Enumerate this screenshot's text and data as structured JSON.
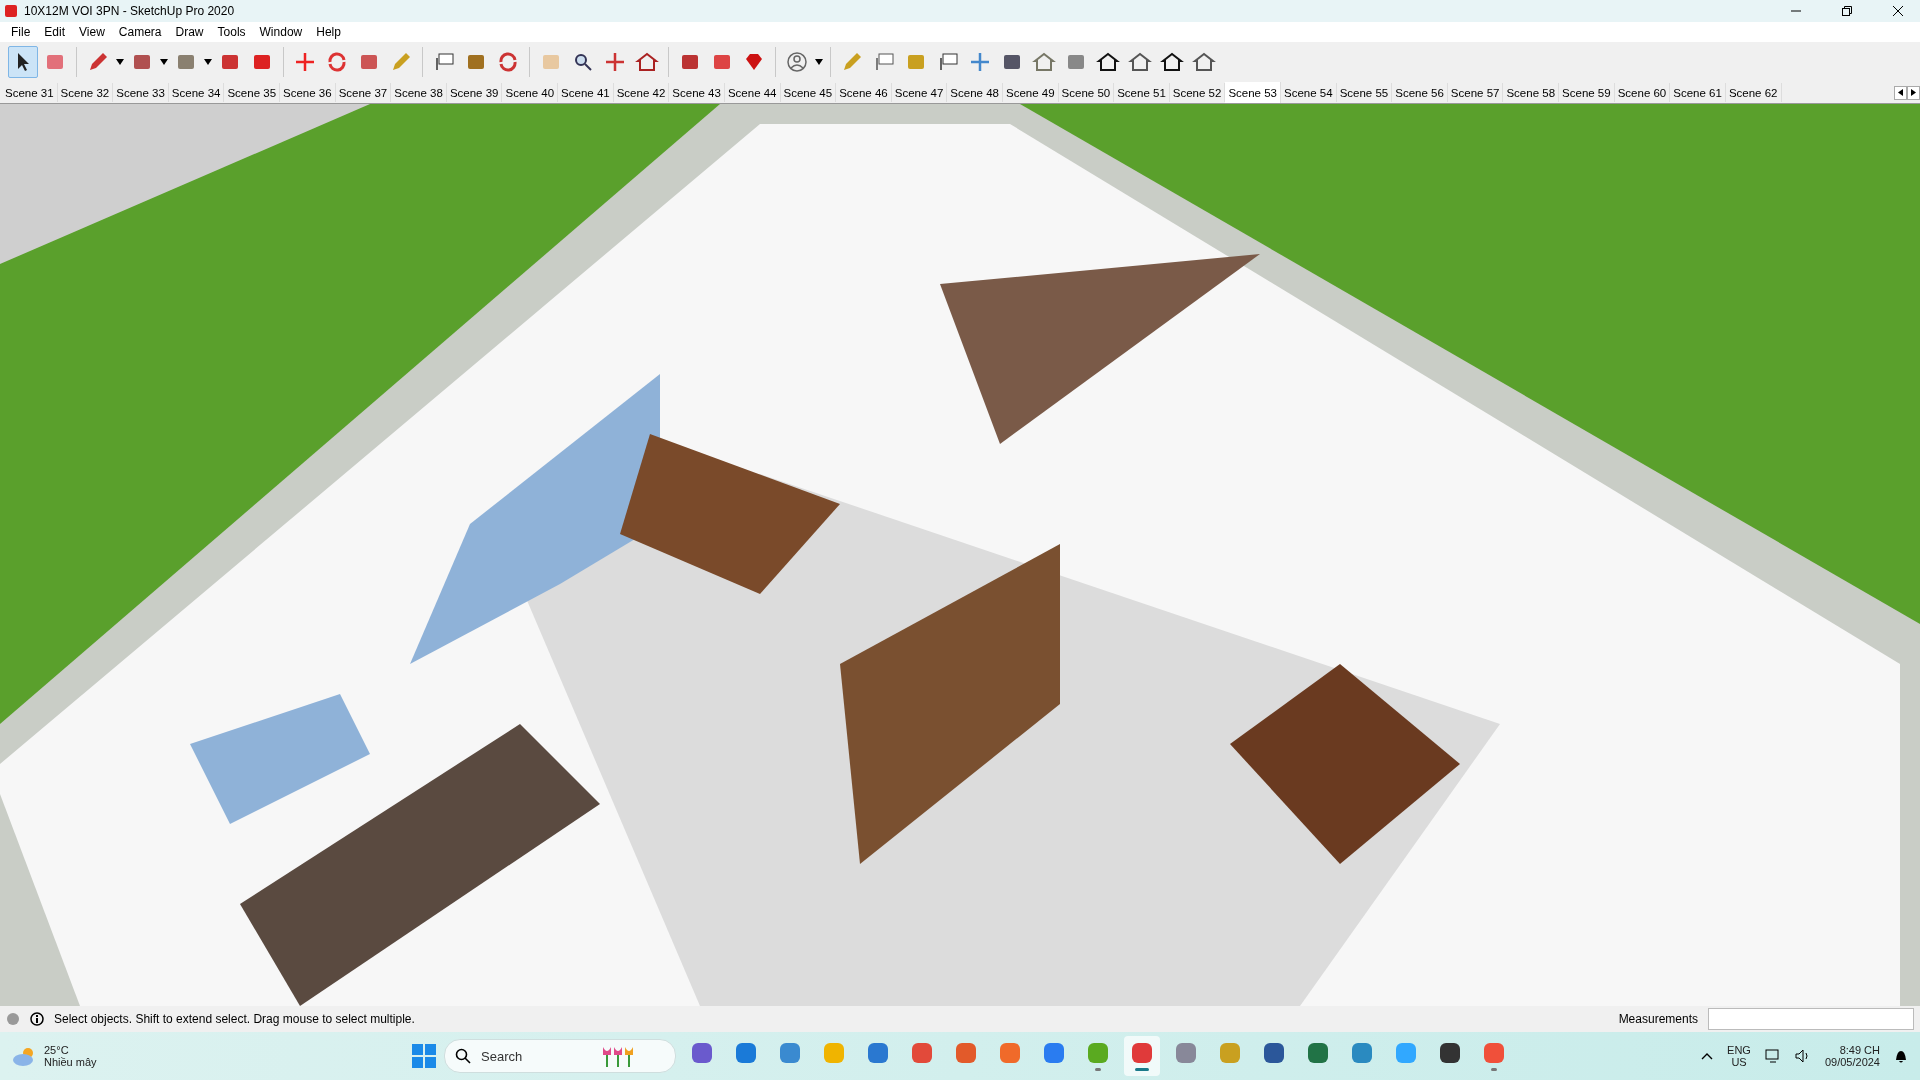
{
  "window": {
    "title": "10X12M VOI 3PN - SketchUp Pro 2020"
  },
  "menu": [
    "File",
    "Edit",
    "View",
    "Camera",
    "Draw",
    "Tools",
    "Window",
    "Help"
  ],
  "toolbar": [
    {
      "selected": true,
      "dropdown": false
    },
    {
      "selected": false,
      "dropdown": false
    },
    {
      "selected": false,
      "dropdown": true
    },
    {
      "selected": false,
      "dropdown": true
    },
    {
      "selected": false,
      "dropdown": true
    },
    {
      "selected": false,
      "dropdown": false
    },
    {
      "selected": false,
      "dropdown": false
    },
    {
      "selected": false,
      "dropdown": false
    },
    {
      "selected": false,
      "dropdown": false
    },
    {
      "selected": false,
      "dropdown": false
    },
    {
      "selected": false,
      "dropdown": false
    },
    {
      "selected": false,
      "dropdown": false
    },
    {
      "selected": false,
      "dropdown": false
    },
    {
      "selected": false,
      "dropdown": false
    },
    {
      "selected": false,
      "dropdown": false
    },
    {
      "selected": false,
      "dropdown": false
    },
    {
      "selected": false,
      "dropdown": false
    },
    {
      "selected": false,
      "dropdown": false
    },
    {
      "selected": false,
      "dropdown": false
    },
    {
      "selected": false,
      "dropdown": false
    },
    {
      "selected": false,
      "dropdown": false
    },
    {
      "selected": false,
      "dropdown": true
    },
    {
      "selected": false,
      "dropdown": false
    },
    {
      "selected": false,
      "dropdown": false
    },
    {
      "selected": false,
      "dropdown": false
    },
    {
      "selected": false,
      "dropdown": false
    },
    {
      "selected": false,
      "dropdown": false
    },
    {
      "selected": false,
      "dropdown": false
    },
    {
      "selected": false,
      "dropdown": false
    },
    {
      "selected": false,
      "dropdown": false
    },
    {
      "selected": false,
      "dropdown": false
    },
    {
      "selected": false,
      "dropdown": false
    },
    {
      "selected": false,
      "dropdown": false
    },
    {
      "selected": false,
      "dropdown": false
    }
  ],
  "scenes": [
    {
      "label": "Scene 31",
      "selected": false
    },
    {
      "label": "Scene 32",
      "selected": false
    },
    {
      "label": "Scene 33",
      "selected": false
    },
    {
      "label": "Scene 34",
      "selected": false
    },
    {
      "label": "Scene 35",
      "selected": false
    },
    {
      "label": "Scene 36",
      "selected": false
    },
    {
      "label": "Scene 37",
      "selected": false
    },
    {
      "label": "Scene 38",
      "selected": false
    },
    {
      "label": "Scene 39",
      "selected": false
    },
    {
      "label": "Scene 40",
      "selected": false
    },
    {
      "label": "Scene 41",
      "selected": false
    },
    {
      "label": "Scene 42",
      "selected": false
    },
    {
      "label": "Scene 43",
      "selected": false
    },
    {
      "label": "Scene 44",
      "selected": false
    },
    {
      "label": "Scene 45",
      "selected": false
    },
    {
      "label": "Scene 46",
      "selected": false
    },
    {
      "label": "Scene 47",
      "selected": false
    },
    {
      "label": "Scene 48",
      "selected": false
    },
    {
      "label": "Scene 49",
      "selected": false
    },
    {
      "label": "Scene 50",
      "selected": false
    },
    {
      "label": "Scene 51",
      "selected": false
    },
    {
      "label": "Scene 52",
      "selected": false
    },
    {
      "label": "Scene 53",
      "selected": true
    },
    {
      "label": "Scene 54",
      "selected": false
    },
    {
      "label": "Scene 55",
      "selected": false
    },
    {
      "label": "Scene 56",
      "selected": false
    },
    {
      "label": "Scene 57",
      "selected": false
    },
    {
      "label": "Scene 58",
      "selected": false
    },
    {
      "label": "Scene 59",
      "selected": false
    },
    {
      "label": "Scene 60",
      "selected": false
    },
    {
      "label": "Scene 61",
      "selected": false
    },
    {
      "label": "Scene 62",
      "selected": false
    }
  ],
  "status_bar": {
    "message": "Select objects. Shift to extend select. Drag mouse to select multiple.",
    "measurements_label": "Measurements"
  },
  "taskbar": {
    "weather": {
      "temperature": "25°C",
      "condition": "Nhiều mây"
    },
    "search": {
      "placeholder": "Search"
    },
    "apps": [
      {
        "running": false,
        "selected": false
      },
      {
        "running": false,
        "selected": false
      },
      {
        "running": false,
        "selected": false
      },
      {
        "running": false,
        "selected": false
      },
      {
        "running": false,
        "selected": false
      },
      {
        "running": false,
        "selected": false
      },
      {
        "running": false,
        "selected": false
      },
      {
        "running": false,
        "selected": false
      },
      {
        "running": false,
        "selected": false
      },
      {
        "running": true,
        "selected": false
      },
      {
        "running": true,
        "selected": true
      },
      {
        "running": false,
        "selected": false
      },
      {
        "running": false,
        "selected": false
      },
      {
        "running": false,
        "selected": false
      },
      {
        "running": false,
        "selected": false
      },
      {
        "running": false,
        "selected": false
      },
      {
        "running": false,
        "selected": false
      },
      {
        "running": false,
        "selected": false
      },
      {
        "running": true,
        "selected": false
      }
    ],
    "language": {
      "line1": "ENG",
      "line2": "US"
    },
    "time": "8:49 CH",
    "date": "09/05/2024"
  }
}
